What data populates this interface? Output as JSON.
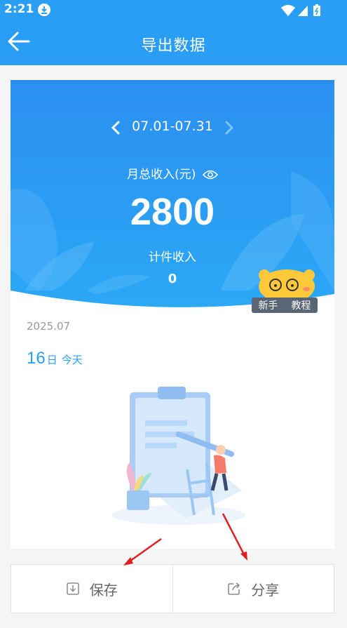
{
  "status_bar": {
    "time": "2:21",
    "icons": [
      "download-icon",
      "wifi-icon",
      "signal-icon",
      "battery-icon"
    ]
  },
  "app_bar": {
    "title": "导出数据",
    "back_icon": "arrow-left-icon"
  },
  "summary": {
    "date_range": "07.01-07.31",
    "month_total_label": "月总收入(元)",
    "month_total_value": "2800",
    "piece_income_label": "计件收入",
    "piece_income_value": "0"
  },
  "tutorial_badge": {
    "word1": "新手",
    "word2": "教程"
  },
  "calendar": {
    "year_month": "2025.07",
    "day": "16",
    "day_unit": "日",
    "today_label": "今天"
  },
  "actions": {
    "save_label": "保存",
    "share_label": "分享"
  },
  "colors": {
    "primary": "#2a9df4",
    "annotation_arrow": "#e02020"
  }
}
